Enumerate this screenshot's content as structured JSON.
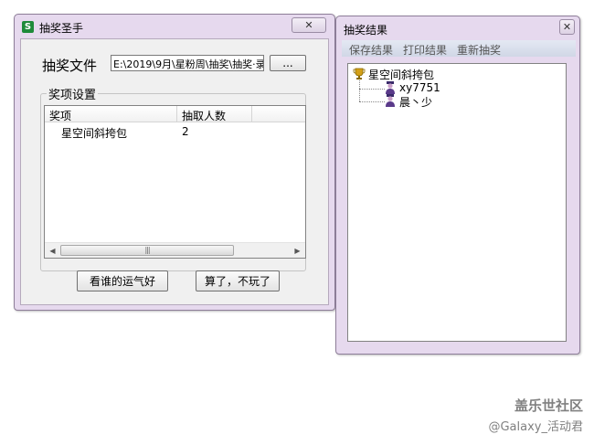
{
  "left_window": {
    "title": "抽奖圣手",
    "close_label": "✕",
    "file_label": "抽奖文件",
    "file_path": "E:\\2019\\9月\\星粉周\\抽奖\\抽奖·录",
    "browse_label": "...",
    "group_title": "奖项设置",
    "columns": [
      "奖项",
      "抽取人数"
    ],
    "rows": [
      {
        "prize": "星空间斜挎包",
        "count": "2"
      }
    ],
    "scroll_thumb_grip": "|||",
    "lucky_button": "看谁的运气好",
    "quit_button": "算了，不玩了"
  },
  "right_window": {
    "title": "抽奖结果",
    "close_label": "✕",
    "toolbar": [
      "保存结果",
      "打印结果",
      "重新抽奖"
    ],
    "tree": {
      "root": "星空间斜挎包",
      "children": [
        "xy7751",
        "晨丶少"
      ]
    }
  },
  "watermark": {
    "line1": "盖乐世社区",
    "line2": "@Galaxy_活动君"
  },
  "colors": {
    "window_frame": "#e6d9ee",
    "client_bg": "#f0f0f0",
    "icon_green": "#1e8a3a"
  }
}
